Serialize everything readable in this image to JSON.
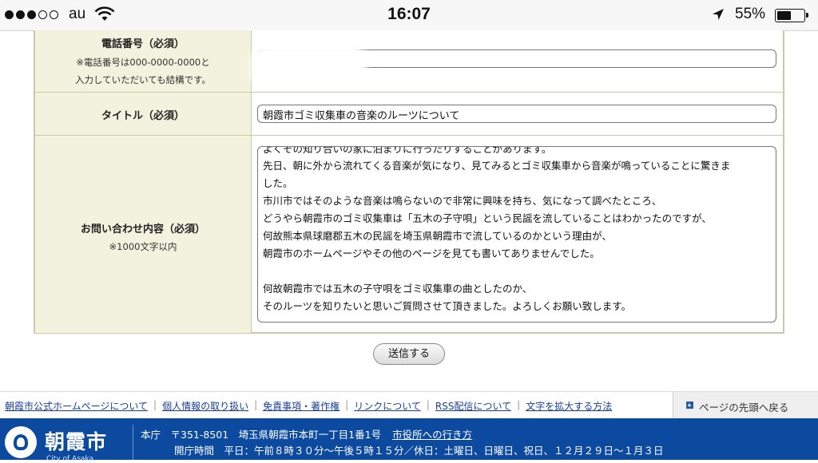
{
  "status": {
    "carrier": "au",
    "time": "16:07",
    "battery": "55%",
    "battery_level": 0.55
  },
  "form": {
    "phone": {
      "label": "電話番号（必須）",
      "note1": "※電話番号は000-0000-0000と",
      "note2": "入力していただいても結構です。"
    },
    "title": {
      "label": "タイトル（必須）",
      "value": "朝霞市ゴミ収集車の音楽のルーツについて"
    },
    "inquiry": {
      "label": "お問い合わせ内容（必須）",
      "note": "※1000文字以内",
      "lines": [
        "よくその知り合いの家に泊まりに行ったりすることがあります。",
        "先日、朝に外から流れてくる音楽が気になり、見てみるとゴミ収集車から音楽が鳴っていることに驚きま",
        "した。",
        "市川市ではそのような音楽は鳴らないので非常に興味を持ち、気になって調べたところ、",
        "どうやら朝霞市のゴミ収集車は「五木の子守唄」という民謡を流していることはわかったのですが、",
        "何故熊本県球磨郡五木の民謡を埼玉県朝霞市で流しているのかという理由が、",
        "朝霞市のホームページやその他のページを見ても書いてありませんでした。",
        "",
        "何故朝霞市では五木の子守唄をゴミ収集車の曲としたのか、",
        "そのルーツを知りたいと思いご質問させて頂きました。よろしくお願い致します。"
      ]
    },
    "submit_label": "送信する"
  },
  "footer_links": {
    "items": [
      "朝霞市公式ホームページについて",
      "個人情報の取り扱い",
      "免責事項・著作権",
      "リンクについて",
      "RSS配信について",
      "文字を拡大する方法"
    ],
    "to_top": "ページの先頭へ戻る"
  },
  "footer": {
    "logo_name": "朝霞市",
    "logo_en": "City of Asaka",
    "address": "本庁　〒351-8501　埼玉県朝霞市本町一丁目1番1号",
    "access_link": "市役所への行き方",
    "hours": "開庁時間　平日：午前８時３０分〜午後５時１５分／休日：土曜日、日曜日、祝日、１２月２９日〜１月３日"
  }
}
